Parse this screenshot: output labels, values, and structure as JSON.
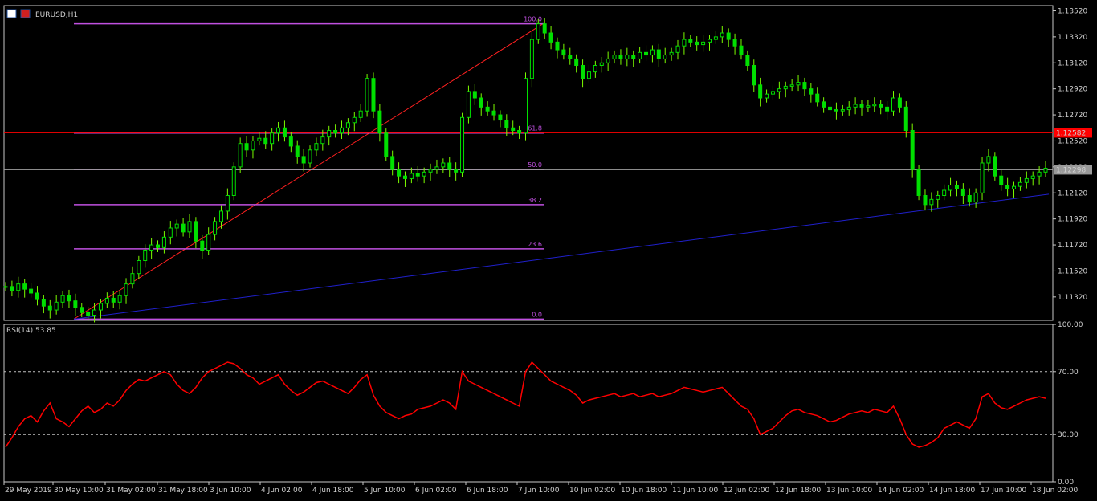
{
  "window": {
    "symbol_label": "EURUSD,H1",
    "icons": [
      "table-icon",
      "symbol-icon"
    ]
  },
  "colors": {
    "background": "#000000",
    "frame": "#c8c8c8",
    "candle": "#00e000",
    "candle_wick": "#7CFC00",
    "fib_levels": "#c050e0",
    "fib_text": "#c050e0",
    "fib_trend": "#ff2020",
    "price_line": "#ff0000",
    "bid_line": "#a0a0a0",
    "trendline": "#2020cc",
    "rsi_line": "#ff0000",
    "rsi_levels": "#c0c0c0"
  },
  "chart_data": [
    {
      "type": "candlestick",
      "title": "EURUSD,H1",
      "yticks": [
        "1.13520",
        "1.13320",
        "1.13120",
        "1.12920",
        "1.12720",
        "1.12520",
        "1.12320",
        "1.12120",
        "1.11920",
        "1.11720",
        "1.11520",
        "1.11320"
      ],
      "ylim": [
        1.1114,
        1.1356
      ],
      "current_price_label": "1.12582",
      "current_price": 1.12582,
      "bid_label": "1.12298",
      "bid": 1.12298,
      "fibonacci": {
        "levels": [
          {
            "label": "100.0",
            "price": 1.1342
          },
          {
            "label": "61.8",
            "price": 1.1258
          },
          {
            "label": "50.0",
            "price": 1.123
          },
          {
            "label": "38.2",
            "price": 1.1203
          },
          {
            "label": "23.6",
            "price": 1.1169
          },
          {
            "label": "0.0",
            "price": 1.1115
          }
        ]
      },
      "trendline": {
        "from_price": 1.1115,
        "to_price": 1.1211
      },
      "price_path": [
        1.114,
        1.1137,
        1.1142,
        1.1138,
        1.1135,
        1.113,
        1.1125,
        1.1122,
        1.1128,
        1.1133,
        1.1129,
        1.1124,
        1.112,
        1.1118,
        1.1122,
        1.1127,
        1.1131,
        1.1128,
        1.1133,
        1.1142,
        1.115,
        1.116,
        1.1168,
        1.1172,
        1.117,
        1.1178,
        1.1185,
        1.1188,
        1.1182,
        1.119,
        1.1175,
        1.1168,
        1.118,
        1.119,
        1.1198,
        1.121,
        1.1232,
        1.125,
        1.1245,
        1.1252,
        1.1254,
        1.125,
        1.1258,
        1.1262,
        1.1255,
        1.1248,
        1.124,
        1.1235,
        1.1245,
        1.125,
        1.1255,
        1.126,
        1.1258,
        1.1262,
        1.1266,
        1.127,
        1.1275,
        1.13,
        1.1275,
        1.1258,
        1.124,
        1.123,
        1.1225,
        1.1223,
        1.1227,
        1.1225,
        1.1228,
        1.123,
        1.1232,
        1.1235,
        1.123,
        1.1228,
        1.127,
        1.129,
        1.1285,
        1.1278,
        1.1275,
        1.1272,
        1.1268,
        1.1262,
        1.126,
        1.1258,
        1.13,
        1.133,
        1.1342,
        1.1335,
        1.1328,
        1.1322,
        1.1318,
        1.1315,
        1.131,
        1.13,
        1.1305,
        1.131,
        1.1312,
        1.1315,
        1.1318,
        1.1315,
        1.1318,
        1.1315,
        1.132,
        1.1318,
        1.1322,
        1.1315,
        1.1318,
        1.132,
        1.1325,
        1.133,
        1.1328,
        1.1326,
        1.1328,
        1.133,
        1.1332,
        1.1335,
        1.133,
        1.1325,
        1.1318,
        1.131,
        1.1295,
        1.1285,
        1.1288,
        1.129,
        1.1292,
        1.1294,
        1.1295,
        1.1297,
        1.1292,
        1.1288,
        1.1282,
        1.1278,
        1.1276,
        1.1275,
        1.1276,
        1.1278,
        1.128,
        1.1278,
        1.1279,
        1.128,
        1.1278,
        1.1275,
        1.1285,
        1.1278,
        1.126,
        1.123,
        1.121,
        1.1203,
        1.1207,
        1.121,
        1.1214,
        1.1218,
        1.1215,
        1.121,
        1.1205,
        1.1212,
        1.1235,
        1.124,
        1.1225,
        1.1218,
        1.1215,
        1.1217,
        1.122,
        1.1223,
        1.1225,
        1.1228,
        1.1231
      ],
      "x_ticks": [
        "29 May 2019",
        "30 May 10:00",
        "31 May 02:00",
        "31 May 18:00",
        "3 Jun 10:00",
        "4 Jun 02:00",
        "4 Jun 18:00",
        "5 Jun 10:00",
        "6 Jun 02:00",
        "6 Jun 18:00",
        "7 Jun 10:00",
        "10 Jun 02:00",
        "10 Jun 18:00",
        "11 Jun 10:00",
        "12 Jun 02:00",
        "12 Jun 18:00",
        "13 Jun 10:00",
        "14 Jun 02:00",
        "14 Jun 18:00",
        "17 Jun 10:00",
        "18 Jun 02:00"
      ]
    },
    {
      "type": "line",
      "title": "RSI(14) 53.85",
      "yticks": [
        "100.00",
        "70.00",
        "30.00",
        "0.00"
      ],
      "ylim": [
        0,
        100
      ],
      "levels": [
        70,
        30
      ],
      "values": [
        22,
        28,
        35,
        40,
        42,
        38,
        45,
        50,
        40,
        38,
        35,
        40,
        45,
        48,
        44,
        46,
        50,
        48,
        52,
        58,
        62,
        65,
        64,
        66,
        68,
        70,
        68,
        62,
        58,
        56,
        60,
        66,
        70,
        72,
        74,
        76,
        75,
        72,
        68,
        66,
        62,
        64,
        66,
        68,
        62,
        58,
        55,
        57,
        60,
        63,
        64,
        62,
        60,
        58,
        56,
        60,
        65,
        68,
        55,
        48,
        44,
        42,
        40,
        42,
        43,
        46,
        47,
        48,
        50,
        52,
        50,
        46,
        70,
        64,
        62,
        60,
        58,
        56,
        54,
        52,
        50,
        48,
        70,
        76,
        72,
        68,
        64,
        62,
        60,
        58,
        55,
        50,
        52,
        53,
        54,
        55,
        56,
        54,
        55,
        56,
        54,
        55,
        56,
        54,
        55,
        56,
        58,
        60,
        59,
        58,
        57,
        58,
        59,
        60,
        56,
        52,
        48,
        46,
        40,
        30,
        32,
        34,
        38,
        42,
        45,
        46,
        44,
        43,
        42,
        40,
        38,
        39,
        41,
        43,
        44,
        45,
        44,
        46,
        45,
        44,
        48,
        40,
        30,
        24,
        22,
        23,
        25,
        28,
        34,
        36,
        38,
        36,
        34,
        40,
        54,
        56,
        50,
        47,
        46,
        48,
        50,
        52,
        53,
        54,
        53
      ]
    }
  ]
}
